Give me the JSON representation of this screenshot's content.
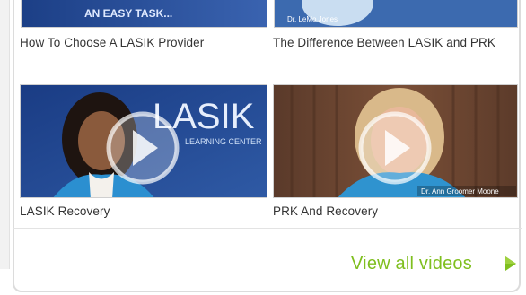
{
  "videos": [
    {
      "title": "How To Choose A LASIK Provider",
      "thumb_text": "AN EASY TASK..."
    },
    {
      "title": "The Difference Between LASIK and PRK",
      "thumb_text": "Dr. LeMo Jones"
    },
    {
      "title": "LASIK Recovery",
      "thumb_text": "LASIK",
      "thumb_subtext": "LEARNING CENTER"
    },
    {
      "title": "PRK And Recovery",
      "thumb_text": "Dr. Ann Groomer Moone"
    }
  ],
  "footer": {
    "view_all_label": "View all videos"
  },
  "colors": {
    "accent": "#7fbf1f",
    "caption": "#333333"
  },
  "icons": {
    "play": "play-icon",
    "arrow": "triangle-right-icon"
  }
}
